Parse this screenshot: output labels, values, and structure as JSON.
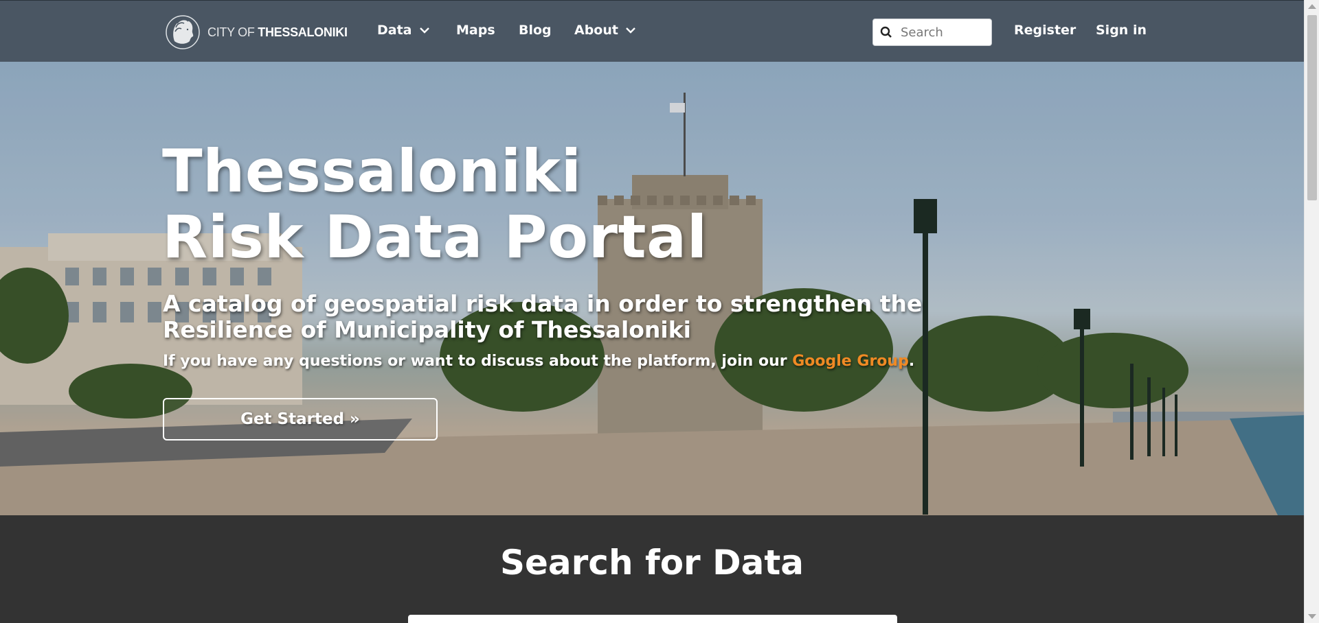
{
  "nav": {
    "logo_text_light": "CITY OF ",
    "logo_text_bold": "THESSALONIKI",
    "items": [
      {
        "label": "Data"
      },
      {
        "label": "Maps"
      },
      {
        "label": "Blog"
      },
      {
        "label": "About"
      }
    ],
    "search_placeholder": "Search",
    "register_label": "Register",
    "signin_label": "Sign in"
  },
  "hero": {
    "title_line1": "Thessaloniki",
    "title_line2": "Risk Data Portal",
    "subtitle": "A catalog of geospatial risk data in order to strengthen the Resilience of Municipality of Thessaloniki",
    "note_prefix": "If you have any questions or want to discuss about the platform, join our ",
    "note_link": "Google Group",
    "note_suffix": ".",
    "cta_label": "Get Started »"
  },
  "search_section": {
    "heading": "Search for Data"
  },
  "colors": {
    "navbar_bg": "#4a5663",
    "link_accent": "#f08a24",
    "section_bg": "#333333"
  }
}
